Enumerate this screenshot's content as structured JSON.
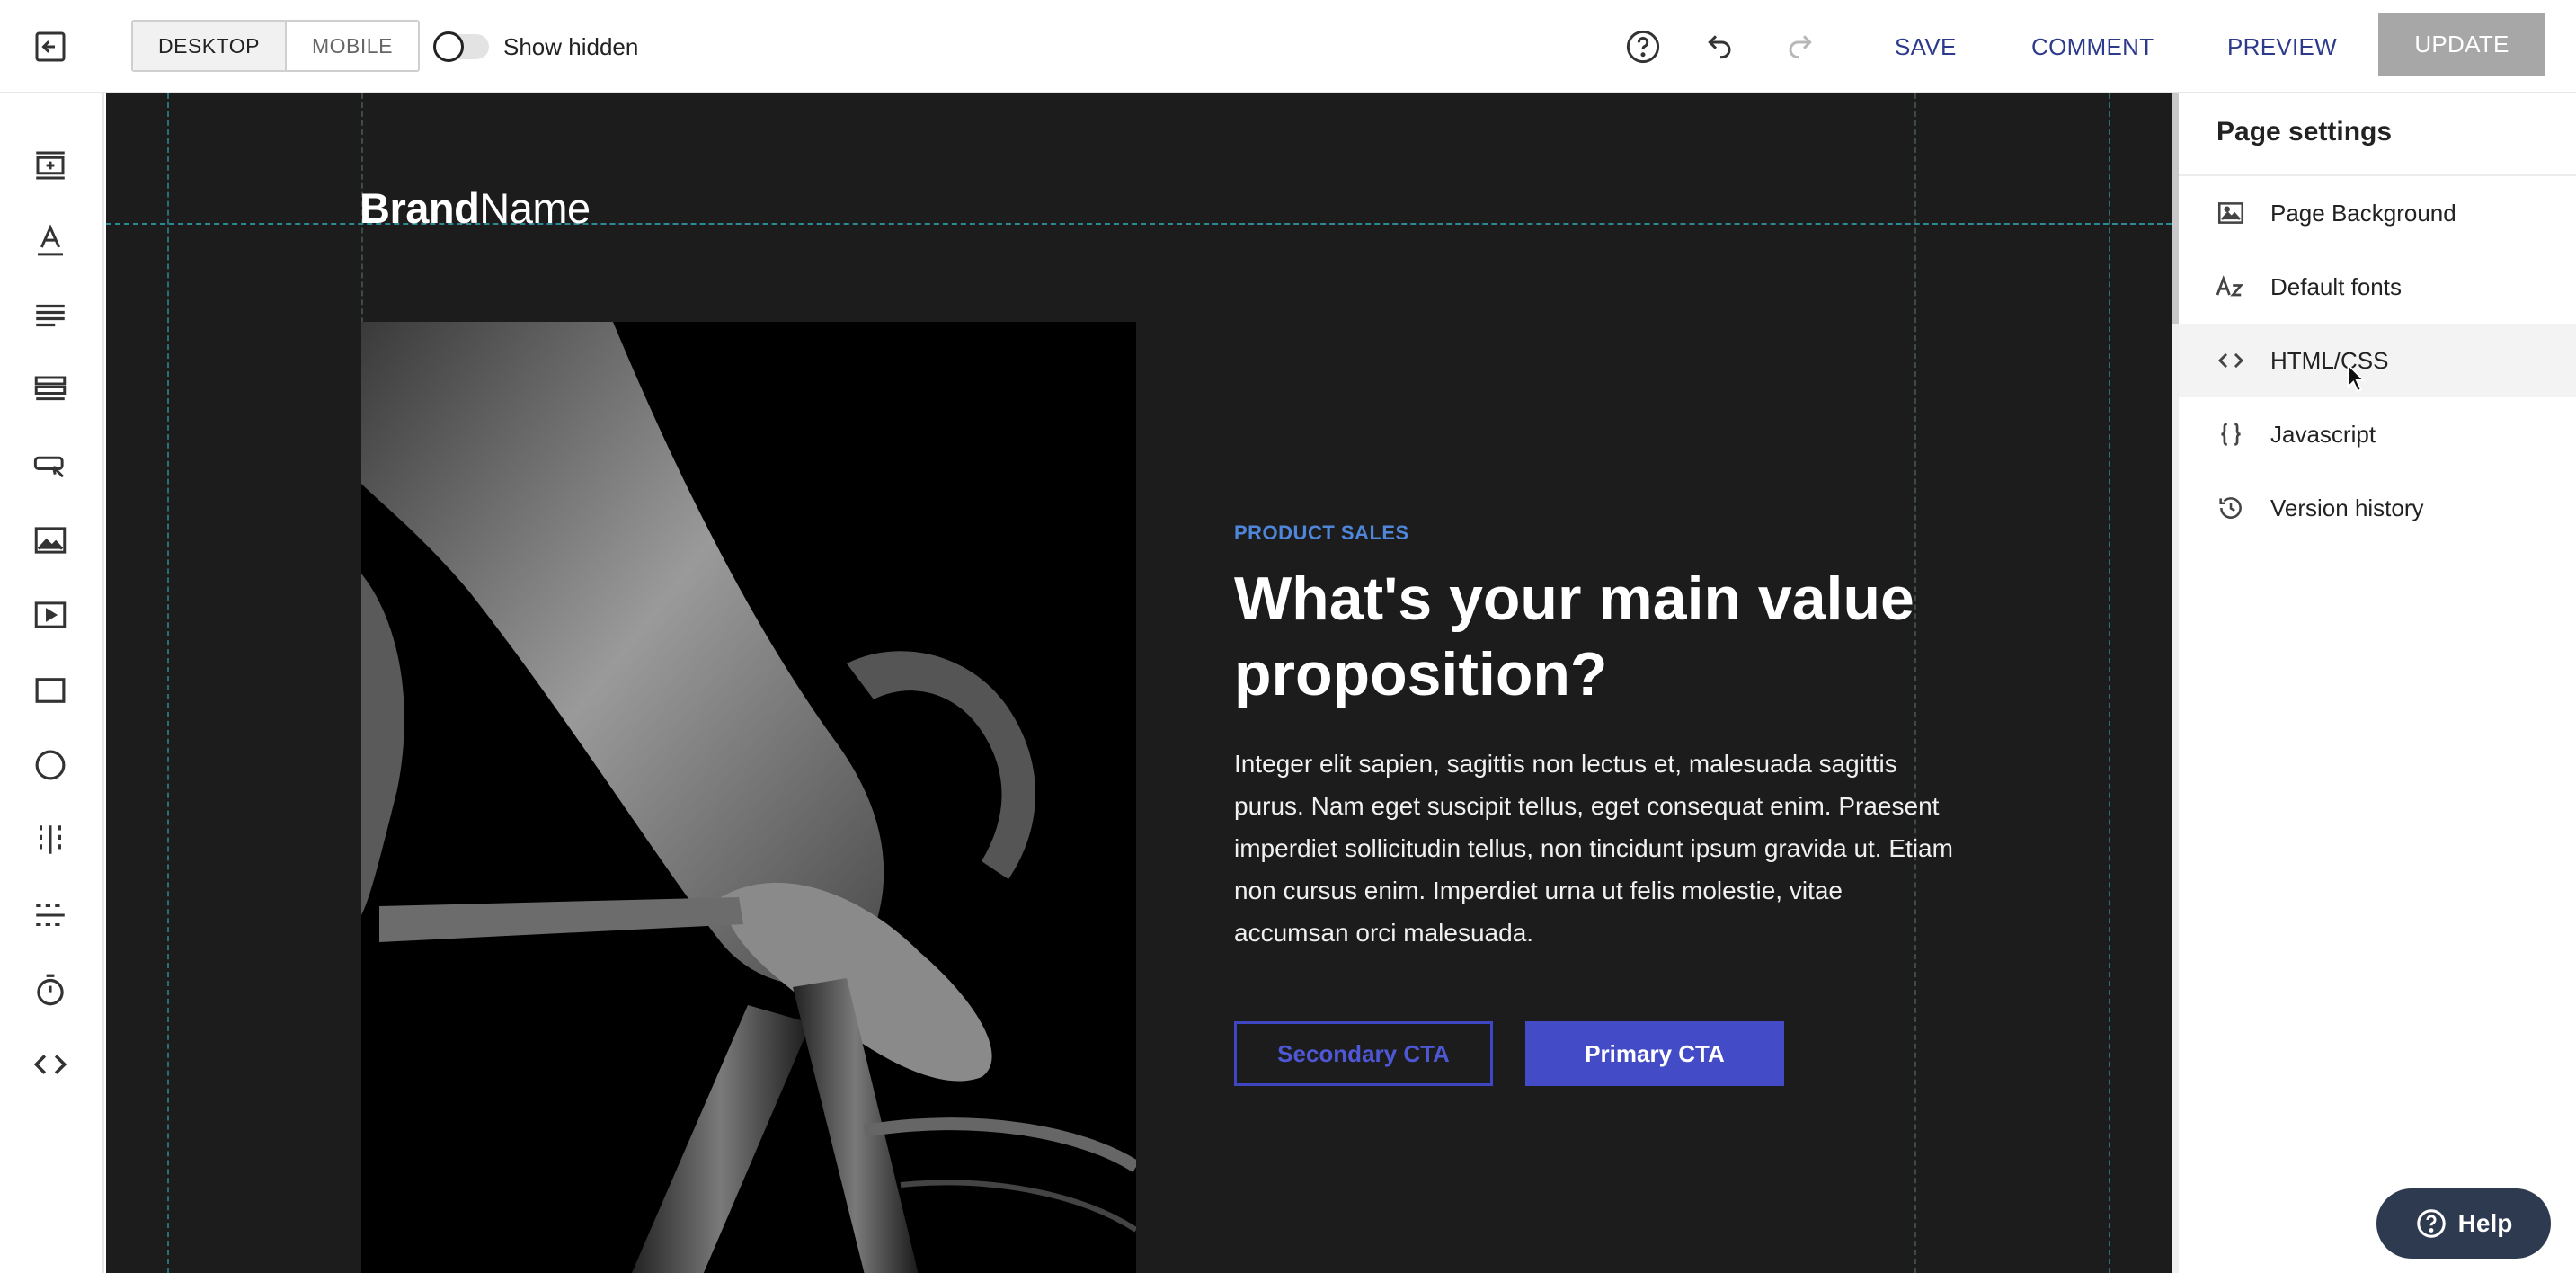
{
  "topbar": {
    "device_desktop": "DESKTOP",
    "device_mobile": "MOBILE",
    "show_hidden_label": "Show hidden",
    "save_label": "SAVE",
    "comment_label": "COMMENT",
    "preview_label": "PREVIEW",
    "update_label": "UPDATE"
  },
  "rail": {
    "tools": [
      "add-section-icon",
      "text-icon",
      "paragraph-icon",
      "list-icon",
      "button-icon",
      "image-icon",
      "video-icon",
      "box-icon",
      "circle-icon",
      "columns-icon",
      "divider-icon",
      "timer-icon",
      "code-icon"
    ]
  },
  "canvas": {
    "brand_bold": "Brand",
    "brand_regular": "Name",
    "eyebrow": "PRODUCT SALES",
    "headline": "What's your main value proposition?",
    "body": "Integer elit sapien, sagittis non lectus et, malesuada sagittis purus. Nam eget suscipit tellus, eget consequat enim. Praesent imperdiet sollicitudin tellus, non tincidunt ipsum gravida ut. Etiam non cursus enim. Imperdiet urna ut felis molestie, vitae accumsan orci malesuada.",
    "secondary_cta": "Secondary CTA",
    "primary_cta": "Primary CTA"
  },
  "panel": {
    "title": "Page settings",
    "items": [
      {
        "label": "Page Background",
        "icon": "image-icon"
      },
      {
        "label": "Default fonts",
        "icon": "font-icon"
      },
      {
        "label": "HTML/CSS",
        "icon": "code-icon"
      },
      {
        "label": "Javascript",
        "icon": "braces-icon"
      },
      {
        "label": "Version history",
        "icon": "history-icon"
      }
    ]
  },
  "help_label": "Help",
  "colors": {
    "canvas_bg": "#1c1c1c",
    "accent": "#434cc6",
    "eyebrow": "#4f86d9",
    "link": "#2d3a8c",
    "update_bg": "#a7a7a7",
    "help_bg": "#2e3a4f"
  }
}
